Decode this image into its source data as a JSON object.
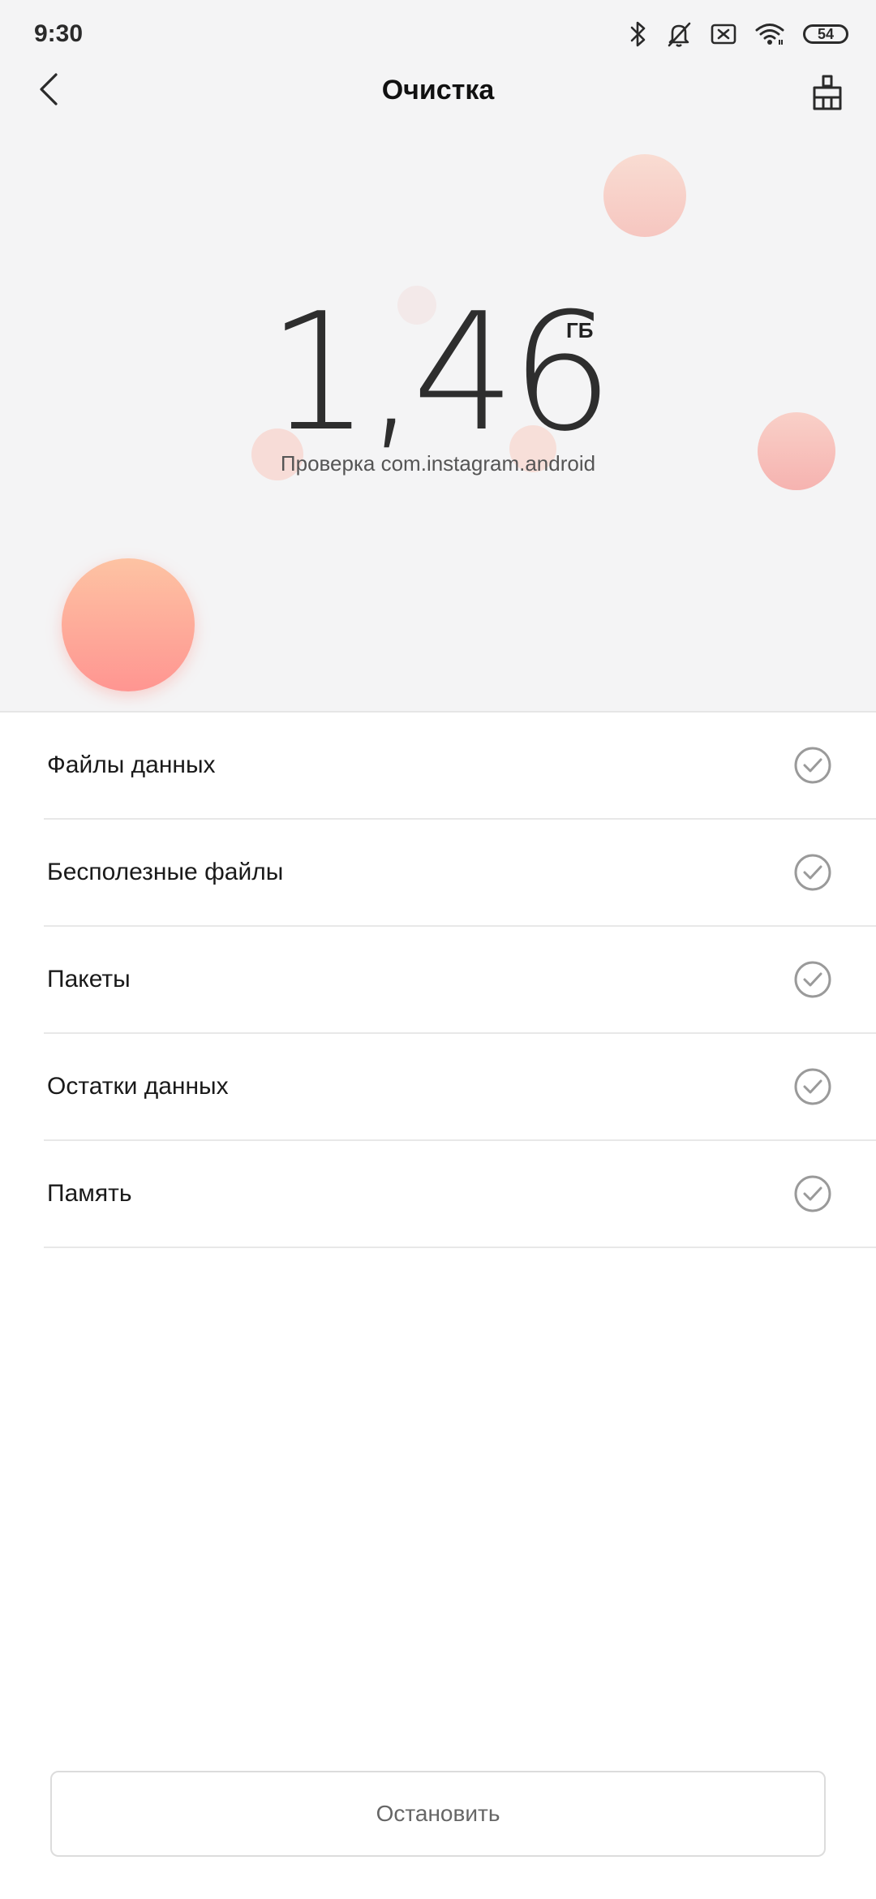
{
  "status": {
    "time": "9:30",
    "battery": "54",
    "icons": [
      "bluetooth-icon",
      "mute-bell-icon",
      "sim-cross-icon",
      "wifi-icon",
      "battery-icon"
    ]
  },
  "header": {
    "title": "Очистка",
    "back_icon": "chevron-left-icon",
    "action_icon": "broom-icon"
  },
  "scan": {
    "value": "1,46",
    "unit": "ГБ",
    "status": "Проверка com.instagram.android"
  },
  "categories": [
    {
      "label": "Файлы данных",
      "icon": "check-circle-icon"
    },
    {
      "label": "Бесполезные файлы",
      "icon": "check-circle-icon"
    },
    {
      "label": "Пакеты",
      "icon": "check-circle-icon"
    },
    {
      "label": "Остатки данных",
      "icon": "check-circle-icon"
    },
    {
      "label": "Память",
      "icon": "check-circle-icon"
    }
  ],
  "footer": {
    "stop_label": "Остановить"
  },
  "colors": {
    "top_background": "#f4f4f5",
    "bubble_accent": "#ff9591",
    "check_color": "#9a9a9a"
  }
}
